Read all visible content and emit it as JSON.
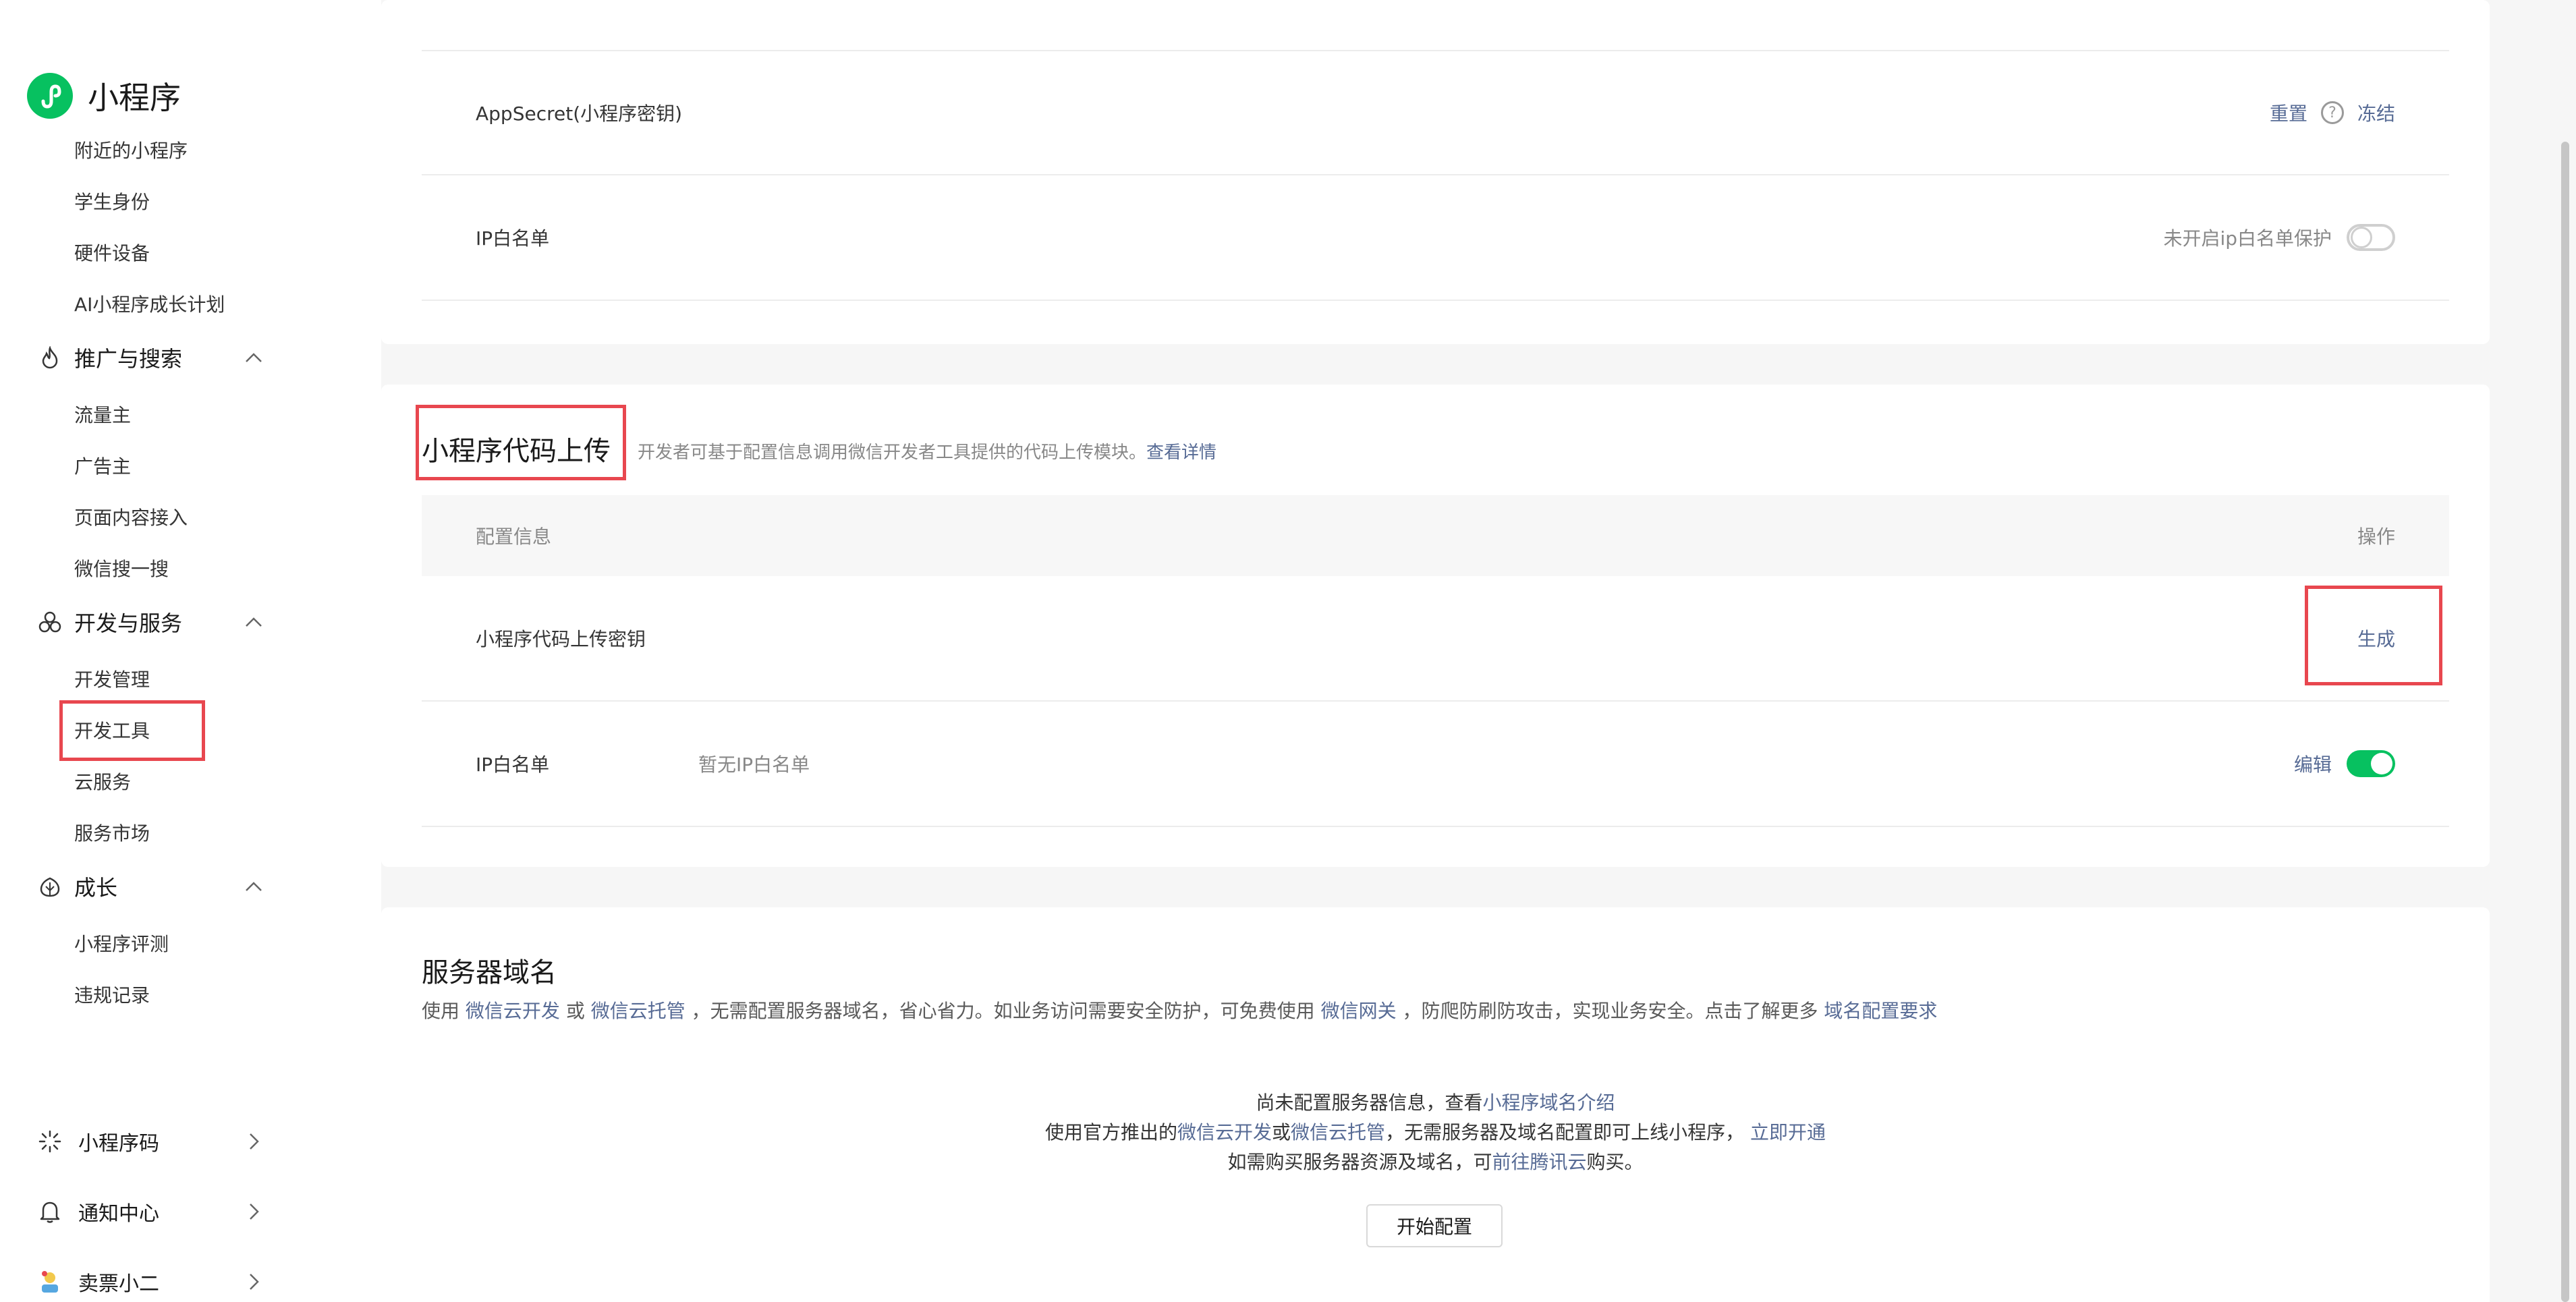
{
  "brand": {
    "title": "小程序"
  },
  "sidebar": {
    "top_items": [
      "附近的小程序",
      "学生身份",
      "硬件设备",
      "AI小程序成长计划"
    ],
    "groups": [
      {
        "label": "推广与搜索",
        "icon": "flame-icon",
        "items": [
          "流量主",
          "广告主",
          "页面内容接入",
          "微信搜一搜"
        ]
      },
      {
        "label": "开发与服务",
        "icon": "cluster-icon",
        "items": [
          "开发管理",
          "开发工具",
          "云服务",
          "服务市场"
        ]
      },
      {
        "label": "成长",
        "icon": "leaf-icon",
        "items": [
          "小程序评测",
          "违规记录"
        ]
      }
    ],
    "bottom": [
      {
        "label": "小程序码",
        "icon": "sun-icon"
      },
      {
        "label": "通知中心",
        "icon": "bell-icon"
      },
      {
        "label": "卖票小二",
        "icon": "avatar-icon"
      }
    ]
  },
  "secret_card": {
    "rows": [
      {
        "label": "AppSecret(小程序密钥)",
        "reset": "重置",
        "freeze": "冻结"
      },
      {
        "label": "IP白名单",
        "status": "未开启ip白名单保护",
        "toggle": "off"
      }
    ]
  },
  "upload_card": {
    "title": "小程序代码上传",
    "desc": "开发者可基于配置信息调用微信开发者工具提供的代码上传模块。",
    "desc_link": "查看详情",
    "head_left": "配置信息",
    "head_right": "操作",
    "rows": [
      {
        "label": "小程序代码上传密钥",
        "action": "生成"
      },
      {
        "label": "IP白名单",
        "value": "暂无IP白名单",
        "action": "编辑",
        "toggle": "on"
      }
    ]
  },
  "domain_card": {
    "title": "服务器域名",
    "desc": {
      "p1": "使用 ",
      "l1": "微信云开发",
      "p2": " 或 ",
      "l2": "微信云托管",
      "p3": " ，无需配置服务器域名，省心省力。如业务访问需要安全防护，可免费使用 ",
      "l3": "微信网关",
      "p4": " ，防爬防刷防攻击，实现业务安全。点击了解更多 ",
      "l4": "域名配置要求"
    },
    "line1": {
      "text": "尚未配置服务器信息，查看",
      "link": "小程序域名介绍"
    },
    "line2": {
      "p1": "使用官方推出的",
      "l1": "微信云开发",
      "p2": "或",
      "l2": "微信云托管",
      "p3": "，无需服务器及域名配置即可上线小程序， ",
      "l3": "立即开通"
    },
    "line3": {
      "p1": "如需购买服务器资源及域名，可",
      "l1": "前往腾讯云",
      "p2": "购买。"
    },
    "button": "开始配置"
  },
  "colors": {
    "accent": "#07c160",
    "link": "#576b95",
    "highlight": "#e8474f"
  }
}
